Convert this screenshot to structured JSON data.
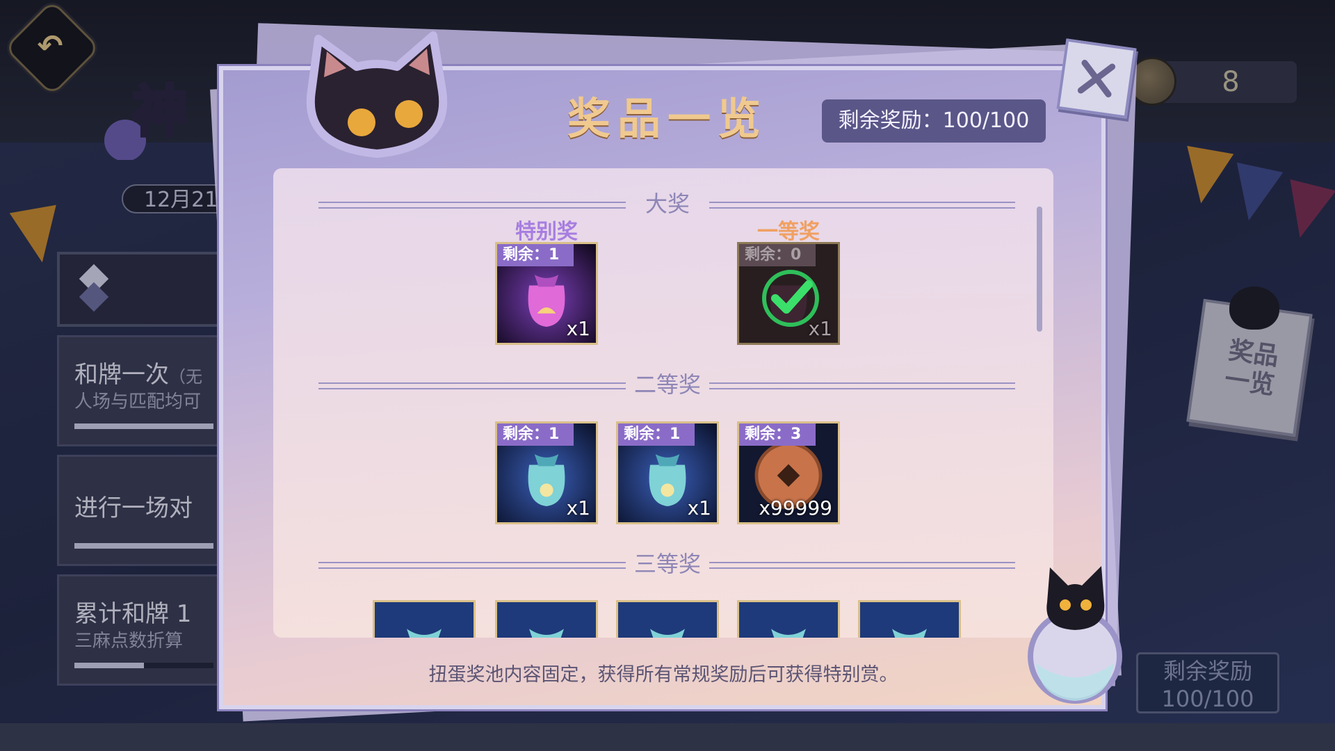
{
  "background": {
    "date_text": "12月21",
    "tasks": [
      {
        "title": "和牌一次",
        "title_suffix": "（无",
        "subtitle": "人场与匹配均可",
        "progress": 1.0
      },
      {
        "title": "进行一场对",
        "title_suffix": "",
        "subtitle": "",
        "progress": 1.0
      },
      {
        "title": "累计和牌 1",
        "title_suffix": "",
        "subtitle": "三麻点数折算",
        "progress": 0.5
      }
    ],
    "currency": {
      "icon": "coin-icon",
      "count": "8"
    },
    "side_poster": {
      "line1": "奖品",
      "line2": "一览"
    },
    "remaining_box": {
      "label": "剩余奖励",
      "value": "100/100"
    }
  },
  "modal": {
    "title": "奖品一览",
    "remaining": "剩余奖励：100/100",
    "close_icon": "close-icon",
    "footer": "扭蛋奖池内容固定，获得所有常规奖励后可获得特别赏。",
    "sections": [
      {
        "title": "大奖",
        "items": [
          {
            "tier": "特别奖",
            "tier_color": "#a77ee0",
            "tag": "剩余：1",
            "qty": "x1",
            "icon": "pink-lucky-bag-icon",
            "claimed": false
          },
          {
            "tier": "一等奖",
            "tier_color": "#f0a062",
            "tag": "剩余：0",
            "qty": "x1",
            "icon": "check-icon",
            "claimed": true
          }
        ]
      },
      {
        "title": "二等奖",
        "items": [
          {
            "tag": "剩余：1",
            "qty": "x1",
            "icon": "teal-lucky-bag-icon"
          },
          {
            "tag": "剩余：1",
            "qty": "x1",
            "icon": "teal-lucky-bag-icon"
          },
          {
            "tag": "剩余：3",
            "qty": "x99999",
            "icon": "copper-coin-icon"
          }
        ]
      },
      {
        "title": "三等奖",
        "items": [
          {
            "icon": "teal-lucky-bag-icon"
          },
          {
            "icon": "teal-lucky-bag-icon"
          },
          {
            "icon": "teal-lucky-bag-icon"
          },
          {
            "icon": "teal-lucky-bag-icon"
          },
          {
            "icon": "teal-lucky-bag-icon"
          }
        ]
      }
    ]
  }
}
